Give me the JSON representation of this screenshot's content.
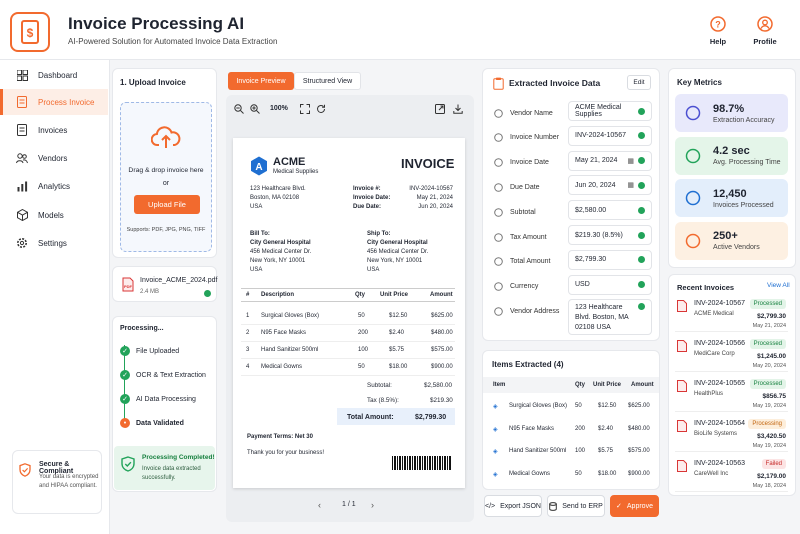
{
  "header": {
    "title": "Invoice Processing AI",
    "subtitle": "AI-Powered Solution for Automated Invoice Data Extraction",
    "help": "Help",
    "profile": "Profile"
  },
  "sidebar": {
    "items": [
      {
        "label": "Dashboard"
      },
      {
        "label": "Process Invoice"
      },
      {
        "label": "Invoices"
      },
      {
        "label": "Vendors"
      },
      {
        "label": "Analytics"
      },
      {
        "label": "Models"
      },
      {
        "label": "Settings"
      }
    ],
    "secure_title": "Secure & Compliant",
    "secure_text": "Your data is encrypted and HIPAA compliant."
  },
  "upload": {
    "title": "1. Upload Invoice",
    "drag_text": "Drag & drop invoice here",
    "or": "or",
    "button": "Upload File",
    "supports": "Supports: PDF, JPG, PNG, TIFF",
    "file_name": "Invoice_ACME_2024.pdf",
    "file_size": "2.4 MB"
  },
  "processing": {
    "title": "Processing...",
    "steps": [
      "File Uploaded",
      "OCR & Text Extraction",
      "AI Data Processing",
      "Data Validated"
    ],
    "done_title": "Processing Completed!",
    "done_text": "Invoice data extracted successfully."
  },
  "preview": {
    "tab_preview": "Invoice Preview",
    "tab_structured": "Structured View",
    "zoom": "100%",
    "page": "1 / 1"
  },
  "invoice": {
    "company": "ACME",
    "company_sub": "Medical Supplies",
    "heading": "INVOICE",
    "addr1": "123 Healthcare Blvd.",
    "addr2": "Boston, MA 02108",
    "addr3": "USA",
    "no_label": "Invoice #:",
    "no": "INV-2024-10567",
    "date_label": "Invoice Date:",
    "date": "May 21, 2024",
    "due_label": "Due Date:",
    "due": "Jun 20, 2024",
    "bill_to": "Bill To:",
    "ship_to": "Ship To:",
    "cust": "City General Hospital",
    "cust1": "456 Medical Center Dr.",
    "cust2": "New York, NY 10001",
    "cust3": "USA",
    "cols": [
      "#",
      "Description",
      "Qty",
      "Unit Price",
      "Amount"
    ],
    "rows": [
      [
        "1",
        "Surgical Gloves (Box)",
        "50",
        "$12.50",
        "$625.00"
      ],
      [
        "2",
        "N95 Face Masks",
        "200",
        "$2.40",
        "$480.00"
      ],
      [
        "3",
        "Hand Sanitizer 500ml",
        "100",
        "$5.75",
        "$575.00"
      ],
      [
        "4",
        "Medical Gowns",
        "50",
        "$18.00",
        "$900.00"
      ]
    ],
    "subtotal_label": "Subtotal:",
    "subtotal": "$2,580.00",
    "tax_label": "Tax (8.5%):",
    "tax": "$219.30",
    "total_label": "Total Amount:",
    "total": "$2,799.30",
    "terms": "Payment Terms: Net 30",
    "thanks": "Thank you for your business!"
  },
  "extracted": {
    "title": "Extracted Invoice Data",
    "edit": "Edit",
    "fields": [
      {
        "label": "Vendor Name",
        "value": "ACME Medical Supplies"
      },
      {
        "label": "Invoice Number",
        "value": "INV-2024-10567"
      },
      {
        "label": "Invoice Date",
        "value": "May 21, 2024"
      },
      {
        "label": "Due Date",
        "value": "Jun 20, 2024"
      },
      {
        "label": "Subtotal",
        "value": "$2,580.00"
      },
      {
        "label": "Tax Amount",
        "value": "$219.30 (8.5%)"
      },
      {
        "label": "Total Amount",
        "value": "$2,799.30"
      },
      {
        "label": "Currency",
        "value": "USD"
      },
      {
        "label": "Vendor Address",
        "value": "123 Healthcare Blvd. Boston, MA 02108 USA"
      }
    ]
  },
  "items": {
    "title": "Items Extracted (4)",
    "cols": [
      "Item",
      "Qty",
      "Unit Price",
      "Amount"
    ],
    "rows": [
      [
        "Surgical Gloves (Box)",
        "50",
        "$12.50",
        "$625.00"
      ],
      [
        "N95 Face Masks",
        "200",
        "$2.40",
        "$480.00"
      ],
      [
        "Hand Sanitizer 500ml",
        "100",
        "$5.75",
        "$575.00"
      ],
      [
        "Medical Gowns",
        "50",
        "$18.00",
        "$900.00"
      ]
    ]
  },
  "actions": {
    "export": "Export JSON",
    "send": "Send to ERP",
    "approve": "Approve"
  },
  "metrics": {
    "title": "Key Metrics",
    "items": [
      {
        "value": "98.7%",
        "label": "Extraction Accuracy",
        "color": "#e8e9fb"
      },
      {
        "value": "4.2 sec",
        "label": "Avg. Processing Time",
        "color": "#e4f5e9"
      },
      {
        "value": "12,450",
        "label": "Invoices Processed",
        "color": "#e3eefb"
      },
      {
        "value": "250+",
        "label": "Active Vendors",
        "color": "#fdf0e2"
      }
    ]
  },
  "recent": {
    "title": "Recent Invoices",
    "view_all": "View All",
    "items": [
      {
        "no": "INV-2024-10567",
        "vendor": "ACME Medical",
        "status": "Processed",
        "amount": "$2,799.30",
        "date": "May 21, 2024"
      },
      {
        "no": "INV-2024-10566",
        "vendor": "MediCare Corp",
        "status": "Processed",
        "amount": "$1,245.00",
        "date": "May 20, 2024"
      },
      {
        "no": "INV-2024-10565",
        "vendor": "HealthPlus",
        "status": "Processed",
        "amount": "$856.75",
        "date": "May 19, 2024"
      },
      {
        "no": "INV-2024-10564",
        "vendor": "BioLife Systems",
        "status": "Processing",
        "amount": "$3,420.50",
        "date": "May 19, 2024"
      },
      {
        "no": "INV-2024-10563",
        "vendor": "CareWell Inc",
        "status": "Failed",
        "amount": "$2,179.00",
        "date": "May 18, 2024"
      }
    ]
  },
  "colors": {
    "accent": "#f26a2e",
    "success": "#22a35a"
  }
}
